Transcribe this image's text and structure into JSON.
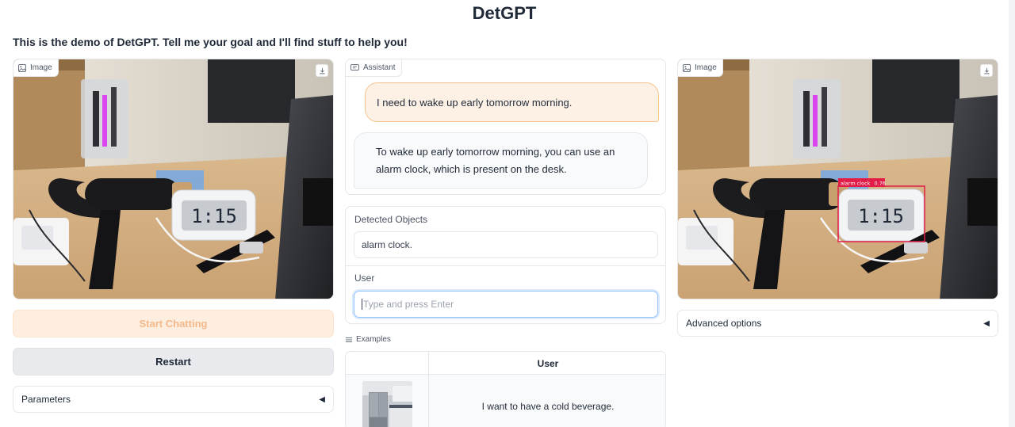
{
  "app": {
    "title": "DetGPT",
    "subtitle": "This is the demo of DetGPT. Tell me your goal and I'll find stuff to help you!"
  },
  "left": {
    "image_label": "Image",
    "image_icon": "image-icon",
    "download_icon": "download-icon",
    "start_label": "Start Chatting",
    "restart_label": "Restart",
    "parameters_label": "Parameters",
    "parameters_toggle": "◀"
  },
  "clock_display": "1:15",
  "chat": {
    "label": "Assistant",
    "messages": [
      {
        "role": "user",
        "text": "I need to wake up early tomorrow morning."
      },
      {
        "role": "assistant",
        "text": "To wake up early tomorrow morning, you can use an alarm clock, which is present on the desk."
      }
    ]
  },
  "detected": {
    "label": "Detected Objects",
    "value": "alarm clock."
  },
  "user_input": {
    "label": "User",
    "placeholder": "Type and press Enter",
    "value": ""
  },
  "examples": {
    "label": "Examples",
    "header_user": "User",
    "rows": [
      {
        "text": "I want to have a cold beverage."
      }
    ]
  },
  "right": {
    "image_label": "Image",
    "detection": {
      "label": "alarm clock",
      "score": "0.76",
      "color": "#e11d48"
    },
    "advanced_label": "Advanced options",
    "advanced_toggle": "◀"
  },
  "colors": {
    "accent": "#f97316",
    "user_bubble": "#fdf1e6",
    "user_bubble_border": "#f6c48f",
    "start_button_bg": "#fdeee0",
    "start_button_text": "#f3b98a",
    "restart_button_bg": "#e9eaed"
  }
}
